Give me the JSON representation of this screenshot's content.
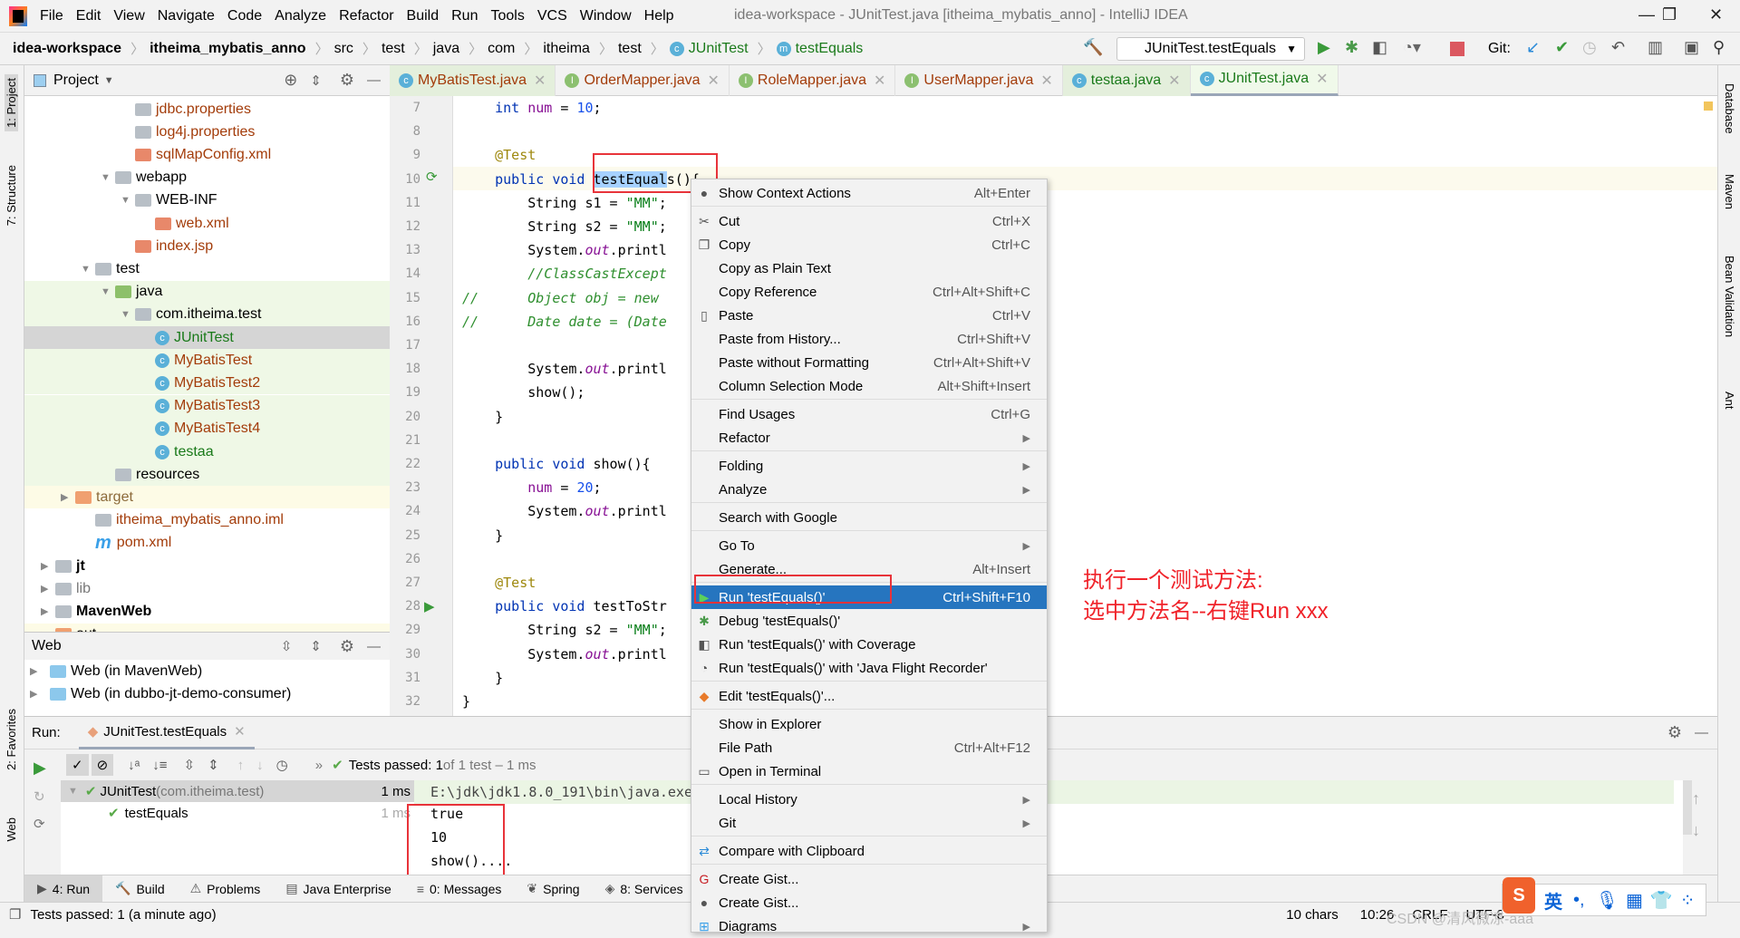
{
  "menubar": {
    "items": [
      "File",
      "Edit",
      "View",
      "Navigate",
      "Code",
      "Analyze",
      "Refactor",
      "Build",
      "Run",
      "Tools",
      "VCS",
      "Window",
      "Help"
    ],
    "window_title": "idea-workspace - JUnitTest.java [itheima_mybatis_anno] - IntelliJ IDEA"
  },
  "breadcrumb": [
    "idea-workspace",
    "itheima_mybatis_anno",
    "src",
    "test",
    "java",
    "com",
    "itheima",
    "test",
    "JUnitTest",
    "testEquals"
  ],
  "toolbar": {
    "run_config": "JUnitTest.testEquals",
    "git_label": "Git:"
  },
  "left_strip": [
    "1: Project",
    "7: Structure",
    "2: Favorites",
    "Web"
  ],
  "right_strip": [
    "Database",
    "Maven",
    "Bean Validation",
    "Ant"
  ],
  "project": {
    "title": "Project",
    "tree": [
      {
        "label": "jdbc.properties",
        "indent": 5,
        "type": "props",
        "color": "red"
      },
      {
        "label": "log4j.properties",
        "indent": 5,
        "type": "props",
        "color": "red"
      },
      {
        "label": "sqlMapConfig.xml",
        "indent": 5,
        "type": "xml",
        "color": "red"
      },
      {
        "label": "webapp",
        "indent": 4,
        "type": "folder",
        "open": true
      },
      {
        "label": "WEB-INF",
        "indent": 5,
        "type": "folder",
        "open": true
      },
      {
        "label": "web.xml",
        "indent": 6,
        "type": "xml",
        "color": "red"
      },
      {
        "label": "index.jsp",
        "indent": 5,
        "type": "jsp",
        "color": "red"
      },
      {
        "label": "test",
        "indent": 3,
        "type": "folder",
        "open": true
      },
      {
        "label": "java",
        "indent": 4,
        "type": "testfolder",
        "open": true,
        "bg": "green"
      },
      {
        "label": "com.itheima.test",
        "indent": 5,
        "type": "folder",
        "open": true,
        "bg": "green"
      },
      {
        "label": "JUnitTest",
        "indent": 6,
        "type": "class",
        "color": "green",
        "selected": true
      },
      {
        "label": "MyBatisTest",
        "indent": 6,
        "type": "class",
        "color": "red",
        "bg": "green"
      },
      {
        "label": "MyBatisTest2",
        "indent": 6,
        "type": "class",
        "color": "red",
        "bg": "green"
      },
      {
        "label": "MyBatisTest3",
        "indent": 6,
        "type": "class",
        "color": "red",
        "bg": "green"
      },
      {
        "label": "MyBatisTest4",
        "indent": 6,
        "type": "class",
        "color": "red",
        "bg": "green"
      },
      {
        "label": "testaa",
        "indent": 6,
        "type": "class",
        "color": "green",
        "bg": "green"
      },
      {
        "label": "resources",
        "indent": 4,
        "type": "resfolder",
        "bg": "green"
      },
      {
        "label": "target",
        "indent": 2,
        "type": "orangefolder",
        "closed": true,
        "color": "brown",
        "bg": "yellow"
      },
      {
        "label": "itheima_mybatis_anno.iml",
        "indent": 3,
        "type": "iml",
        "color": "red"
      },
      {
        "label": "pom.xml",
        "indent": 3,
        "type": "maven",
        "color": "red"
      },
      {
        "label": "jt",
        "indent": 1,
        "type": "module",
        "closed": true,
        "bold": true
      },
      {
        "label": "lib",
        "indent": 1,
        "type": "folder",
        "closed": true,
        "color": "gray"
      },
      {
        "label": "MavenWeb",
        "indent": 1,
        "type": "module",
        "closed": true,
        "bold": true
      },
      {
        "label": "out",
        "indent": 1,
        "type": "orangefolder",
        "closed": true,
        "bg": "yellow"
      }
    ]
  },
  "web": {
    "title": "Web",
    "items": [
      "Web (in MavenWeb)",
      "Web (in dubbo-jt-demo-consumer)"
    ]
  },
  "tabs": [
    {
      "label": "MyBatisTest.java",
      "icon": "class",
      "color": "red",
      "green": true
    },
    {
      "label": "OrderMapper.java",
      "icon": "interface",
      "color": "red"
    },
    {
      "label": "RoleMapper.java",
      "icon": "interface",
      "color": "red"
    },
    {
      "label": "UserMapper.java",
      "icon": "interface",
      "color": "red"
    },
    {
      "label": "testaa.java",
      "icon": "class",
      "color": "green",
      "green": true
    },
    {
      "label": "JUnitTest.java",
      "icon": "class",
      "color": "green",
      "active": true
    }
  ],
  "code": {
    "lines": [
      {
        "n": "7",
        "html": "    <span class='kw'>int</span> <span class='fld'>num</span> = <span class='num'>10</span>;"
      },
      {
        "n": "8",
        "html": ""
      },
      {
        "n": "9",
        "html": "    <span class='ann'>@Test</span>"
      },
      {
        "n": "10",
        "html": "    <span class='kw'>public void</span> <span class='hl'>testEqual</span>s(){"
      },
      {
        "n": "11",
        "html": "        String s1 = <span class='str'>\"MM\"</span>;"
      },
      {
        "n": "12",
        "html": "        String s2 = <span class='str'>\"MM\"</span>;"
      },
      {
        "n": "13",
        "html": "        System.<span class='fld it'>out</span>.printl"
      },
      {
        "n": "14",
        "html": "        <span class='cm'>//ClassCastExcept</span>"
      },
      {
        "n": "15",
        "html": "<span class='cm'>//      Object obj = new</span>"
      },
      {
        "n": "16",
        "html": "<span class='cm'>//      Date date = (Date</span>"
      },
      {
        "n": "17",
        "html": ""
      },
      {
        "n": "18",
        "html": "        System.<span class='fld it'>out</span>.printl"
      },
      {
        "n": "19",
        "html": "        show();"
      },
      {
        "n": "20",
        "html": "    }"
      },
      {
        "n": "21",
        "html": ""
      },
      {
        "n": "22",
        "html": "    <span class='kw'>public void</span> show(){"
      },
      {
        "n": "23",
        "html": "        <span class='fld'>num</span> = <span class='num'>20</span>;"
      },
      {
        "n": "24",
        "html": "        System.<span class='fld it'>out</span>.printl"
      },
      {
        "n": "25",
        "html": "    }"
      },
      {
        "n": "26",
        "html": ""
      },
      {
        "n": "27",
        "html": "    <span class='ann'>@Test</span>"
      },
      {
        "n": "28",
        "html": "    <span class='kw'>public void</span> testToStr"
      },
      {
        "n": "29",
        "html": "        String s2 = <span class='str'>\"MM\"</span>;"
      },
      {
        "n": "30",
        "html": "        System.<span class='fld it'>out</span>.printl"
      },
      {
        "n": "31",
        "html": "    }"
      },
      {
        "n": "32",
        "html": "}"
      }
    ]
  },
  "context_menu": [
    [
      {
        "label": "Show Context Actions",
        "key": "Alt+Enter",
        "icon": "bulb-icon"
      }
    ],
    [
      {
        "label": "Cut",
        "key": "Ctrl+X",
        "icon": "scissors-icon"
      },
      {
        "label": "Copy",
        "key": "Ctrl+C",
        "icon": "copy-icon"
      },
      {
        "label": "Copy as Plain Text"
      },
      {
        "label": "Copy Reference",
        "key": "Ctrl+Alt+Shift+C"
      },
      {
        "label": "Paste",
        "key": "Ctrl+V",
        "icon": "clipboard-icon"
      },
      {
        "label": "Paste from History...",
        "key": "Ctrl+Shift+V"
      },
      {
        "label": "Paste without Formatting",
        "key": "Ctrl+Alt+Shift+V"
      },
      {
        "label": "Column Selection Mode",
        "key": "Alt+Shift+Insert"
      }
    ],
    [
      {
        "label": "Find Usages",
        "key": "Ctrl+G"
      },
      {
        "label": "Refactor",
        "sub": true
      }
    ],
    [
      {
        "label": "Folding",
        "sub": true
      },
      {
        "label": "Analyze",
        "sub": true
      }
    ],
    [
      {
        "label": "Search with Google"
      }
    ],
    [
      {
        "label": "Go To",
        "sub": true
      },
      {
        "label": "Generate...",
        "key": "Alt+Insert"
      }
    ],
    [
      {
        "label": "Run 'testEquals()'",
        "key": "Ctrl+Shift+F10",
        "icon": "run-icon",
        "selected": true
      },
      {
        "label": "Debug 'testEquals()'",
        "icon": "debug-icon"
      },
      {
        "label": "Run 'testEquals()' with Coverage",
        "icon": "coverage-icon"
      },
      {
        "label": "Run 'testEquals()' with 'Java Flight Recorder'",
        "icon": "profiler-icon"
      }
    ],
    [
      {
        "label": "Edit 'testEquals()'...",
        "icon": "edit-config-icon"
      }
    ],
    [
      {
        "label": "Show in Explorer"
      },
      {
        "label": "File Path",
        "key": "Ctrl+Alt+F12"
      },
      {
        "label": "Open in Terminal",
        "icon": "terminal-icon"
      }
    ],
    [
      {
        "label": "Local History",
        "sub": true
      },
      {
        "label": "Git",
        "sub": true
      }
    ],
    [
      {
        "label": "Compare with Clipboard",
        "icon": "compare-icon"
      }
    ],
    [
      {
        "label": "Create Gist...",
        "icon": "gitee-icon"
      },
      {
        "label": "Create Gist...",
        "icon": "github-icon"
      },
      {
        "label": "Diagrams",
        "sub": true,
        "icon": "diagram-icon"
      }
    ]
  ],
  "annotation": {
    "line1": "执行一个测试方法:",
    "line2": "选中方法名--右键Run xxx"
  },
  "run": {
    "label": "Run:",
    "tab": "JUnitTest.testEquals",
    "summary_bold": "Tests passed: 1",
    "summary_rest": " of 1 test – 1 ms",
    "tree": [
      {
        "label": "JUnitTest",
        "pkg": " (com.itheima.test)",
        "time": "1 ms"
      },
      {
        "label": "testEquals",
        "time": "1 ms"
      }
    ],
    "console": [
      "E:\\jdk\\jdk1.8.0_191\\bin\\java.exe ...",
      "true",
      "10",
      "show()...."
    ]
  },
  "bottom_tabs": [
    "4: Run",
    "Build",
    "Problems",
    "Java Enterprise",
    "0: Messages",
    "Spring",
    "8: Services"
  ],
  "status": {
    "message": "Tests passed: 1 (a minute ago)",
    "chars": "10 chars",
    "pos": "10:26",
    "eol": "CRLF",
    "enc": "UTF-8"
  },
  "ime": {
    "lang": "英"
  },
  "watermark": "CSDN @清风微凉-aaa",
  "colors": {
    "accent": "#2675bf",
    "highlight_box": "#e8333a",
    "note": "#f0232a"
  }
}
